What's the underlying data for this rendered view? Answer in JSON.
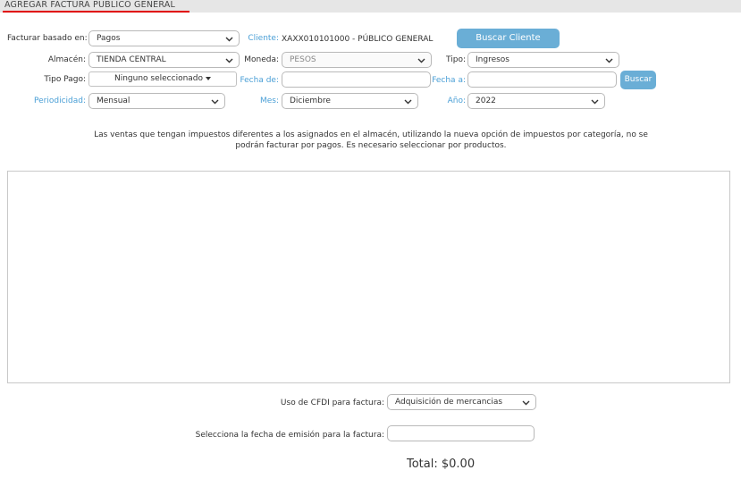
{
  "header": {
    "title": "AGREGAR FACTURA PÚBLICO GENERAL"
  },
  "form": {
    "facturar_basado_label": "Facturar basado en:",
    "facturar_basado_value": "Pagos",
    "cliente_label": "Cliente:",
    "cliente_value": "XAXX010101000 - PÚBLICO GENERAL",
    "buscar_cliente_label": "Buscar Cliente",
    "almacen_label": "Almacén:",
    "almacen_value": "TIENDA CENTRAL",
    "moneda_label": "Moneda:",
    "moneda_value": "PESOS",
    "tipo_label": "Tipo:",
    "tipo_value": "Ingresos",
    "tipo_pago_label": "Tipo Pago:",
    "tipo_pago_value": "Ninguno seleccionado",
    "fecha_de_label": "Fecha de:",
    "fecha_de_value": "",
    "fecha_a_label": "Fecha a:",
    "fecha_a_value": "",
    "buscar_label": "Buscar",
    "periodicidad_label": "Periodicidad:",
    "periodicidad_value": "Mensual",
    "mes_label": "Mes:",
    "mes_value": "Diciembre",
    "anio_label": "Año:",
    "anio_value": "2022"
  },
  "notice": {
    "line1": "Las ventas que tengan impuestos diferentes a los asignados en el almacén, utilizando la nueva opción de impuestos por categoría, no se",
    "line2": "podrán facturar por pagos. Es necesario seleccionar por productos."
  },
  "footer": {
    "uso_cfdi_label": "Uso de CFDI para factura:",
    "uso_cfdi_value": "Adquisición de mercancias",
    "fecha_emision_label": "Selecciona la fecha de emisión para la factura:",
    "fecha_emision_value": "",
    "total_label": "Total: $0.00"
  },
  "colors": {
    "accent": "#6aaed6",
    "label_blue": "#4a9fd6",
    "header_underline": "#e00000",
    "header_bg": "#e6e6e6"
  },
  "icons": {
    "select_chevron": "chevron-down-icon",
    "dropdown_caret": "caret-down-icon"
  }
}
